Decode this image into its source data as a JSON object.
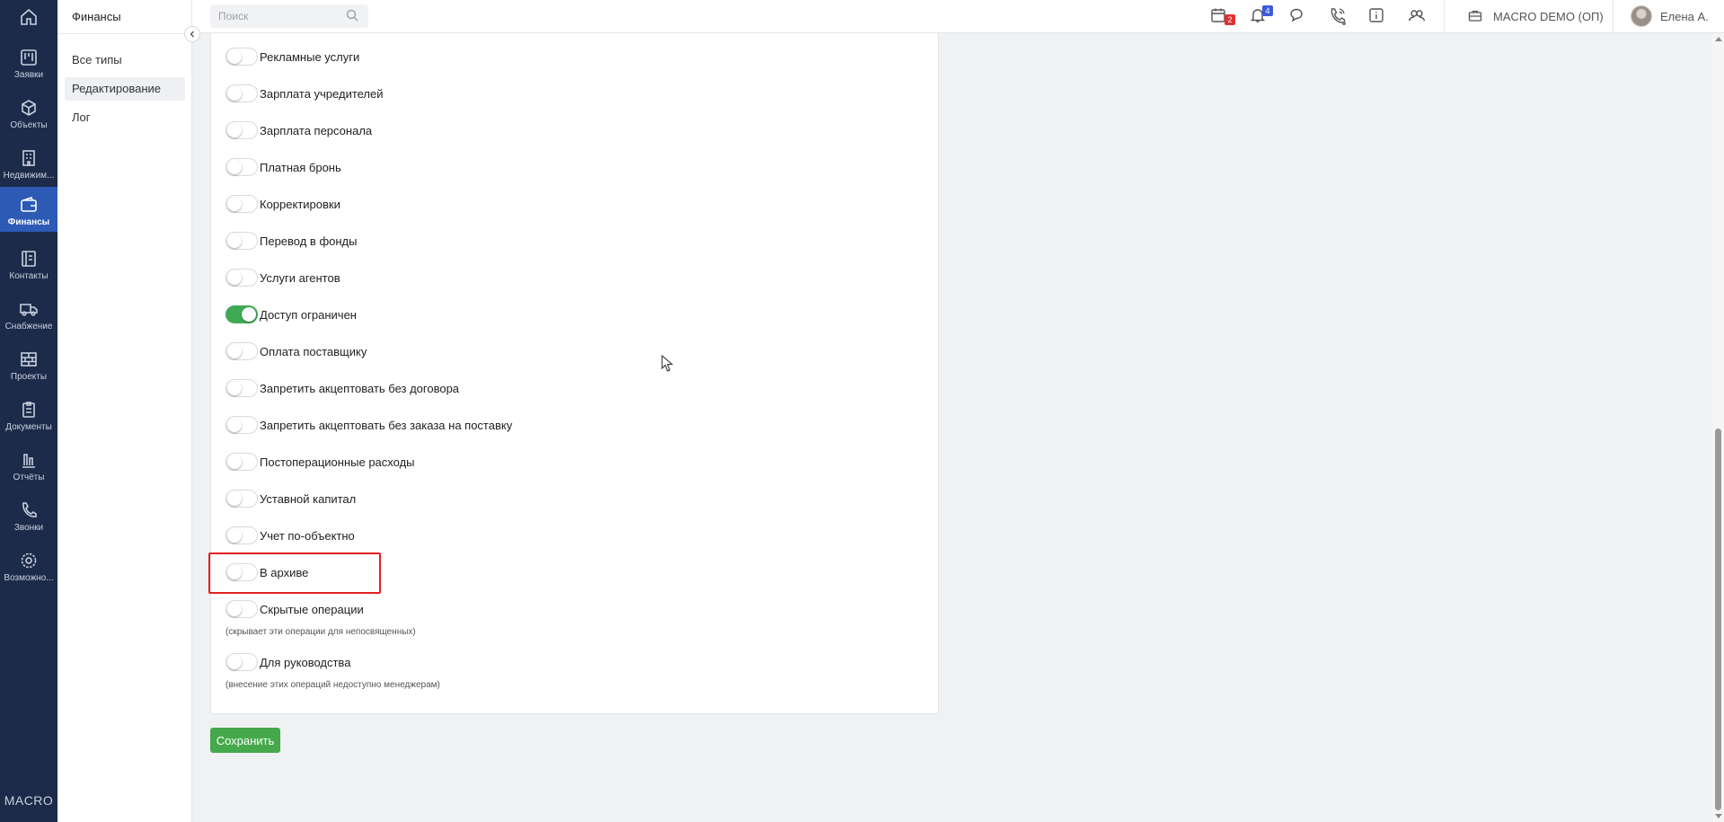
{
  "nav": {
    "items": [
      {
        "label": ""
      },
      {
        "label": "Заявки"
      },
      {
        "label": "Объекты"
      },
      {
        "label": "Недвижим..."
      },
      {
        "label": "Финансы"
      },
      {
        "label": "Контакты"
      },
      {
        "label": "Снабжение"
      },
      {
        "label": "Проекты"
      },
      {
        "label": "Документы"
      },
      {
        "label": "Отчёты"
      },
      {
        "label": "Звонки"
      },
      {
        "label": "Возможно..."
      }
    ],
    "active": "Финансы",
    "brand": "MACRO"
  },
  "submenu": {
    "title": "Финансы",
    "items": [
      {
        "label": "Все типы"
      },
      {
        "label": "Редактирование"
      },
      {
        "label": "Лог"
      }
    ],
    "active": "Редактирование"
  },
  "topbar": {
    "search_placeholder": "Поиск",
    "calendar_badge": "2",
    "notifications_badge": "4",
    "company": "MACRO DEMO (ОП)",
    "user": "Елена А."
  },
  "settings": {
    "toggles": [
      {
        "label": "Рекламные услуги",
        "on": false
      },
      {
        "label": "Зарплата учредителей",
        "on": false
      },
      {
        "label": "Зарплата персонала",
        "on": false
      },
      {
        "label": "Платная бронь",
        "on": false
      },
      {
        "label": "Корректировки",
        "on": false
      },
      {
        "label": "Перевод в фонды",
        "on": false
      },
      {
        "label": "Услуги агентов",
        "on": false
      },
      {
        "label": "Доступ ограничен",
        "on": true
      },
      {
        "label": "Оплата поставщику",
        "on": false
      },
      {
        "label": "Запретить акцептовать без договора",
        "on": false
      },
      {
        "label": "Запретить акцептовать без заказа на поставку",
        "on": false
      },
      {
        "label": "Постоперационные расходы",
        "on": false
      },
      {
        "label": "Уставной капитал",
        "on": false
      },
      {
        "label": "Учет по-объектно",
        "on": false
      },
      {
        "label": "В архиве",
        "on": false
      },
      {
        "label": "Скрытые операции",
        "on": false,
        "hint": "(скрывает эти операции для непосвященных)"
      },
      {
        "label": "Для руководства",
        "on": false,
        "hint": "(внесение этих операций недоступно менеджерам)"
      }
    ],
    "save_label": "Сохранить"
  },
  "colors": {
    "sidebar_bg": "#1d2b4a",
    "active_nav": "#2d5ab5",
    "toggle_on": "#3eaa54",
    "save_button": "#45a84b",
    "highlight": "#e32020"
  }
}
